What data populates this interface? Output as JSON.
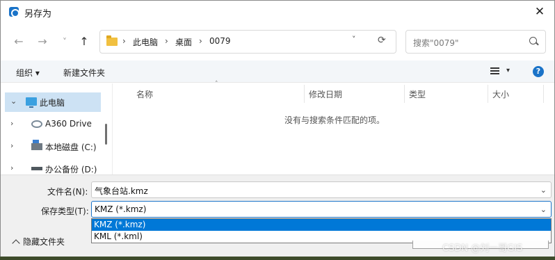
{
  "window": {
    "title": "另存为",
    "close": "✕"
  },
  "nav": {
    "back": "←",
    "forward": "→",
    "recent": "˅",
    "up": "↑"
  },
  "address": {
    "crumbs": [
      "此电脑",
      "桌面",
      "0079"
    ],
    "separator": "›",
    "dropdown": "˅",
    "refresh": "⟳"
  },
  "search": {
    "placeholder": "搜索\"0079\""
  },
  "toolbar": {
    "organize": "组织 ▾",
    "new_folder": "新建文件夹",
    "view_dropdown": "▾",
    "help": "?"
  },
  "sidebar": {
    "items": [
      {
        "label": "此电脑",
        "chevron": "⌄",
        "icon": "pc-icon",
        "selected": true
      },
      {
        "label": "A360 Drive",
        "chevron": "›",
        "icon": "cloud-icon"
      },
      {
        "label": "本地磁盘 (C:)",
        "chevron": "›",
        "icon": "disk-icon"
      },
      {
        "label": "办公备份 (D:)",
        "chevron": "›",
        "icon": "drive-icon"
      }
    ]
  },
  "filelist": {
    "columns": [
      "名称",
      "修改日期",
      "类型",
      "大小"
    ],
    "sort_indicator": "˄",
    "empty_message": "没有与搜索条件匹配的项。"
  },
  "form": {
    "filename_label": "文件名(N):",
    "filename_value": "气象台站.kmz",
    "filetype_label": "保存类型(T):",
    "filetype_value": "KMZ (*.kmz)",
    "dropdown_arrow": "⌄",
    "filetype_options": [
      "KMZ (*.kmz)",
      "KML (*.kml)"
    ]
  },
  "footer": {
    "hide_folders": "隐藏文件夹"
  },
  "watermark": "CSDN @刘一哥GIS",
  "colors": {
    "accent": "#0078d7",
    "selection": "#cde2f4"
  }
}
